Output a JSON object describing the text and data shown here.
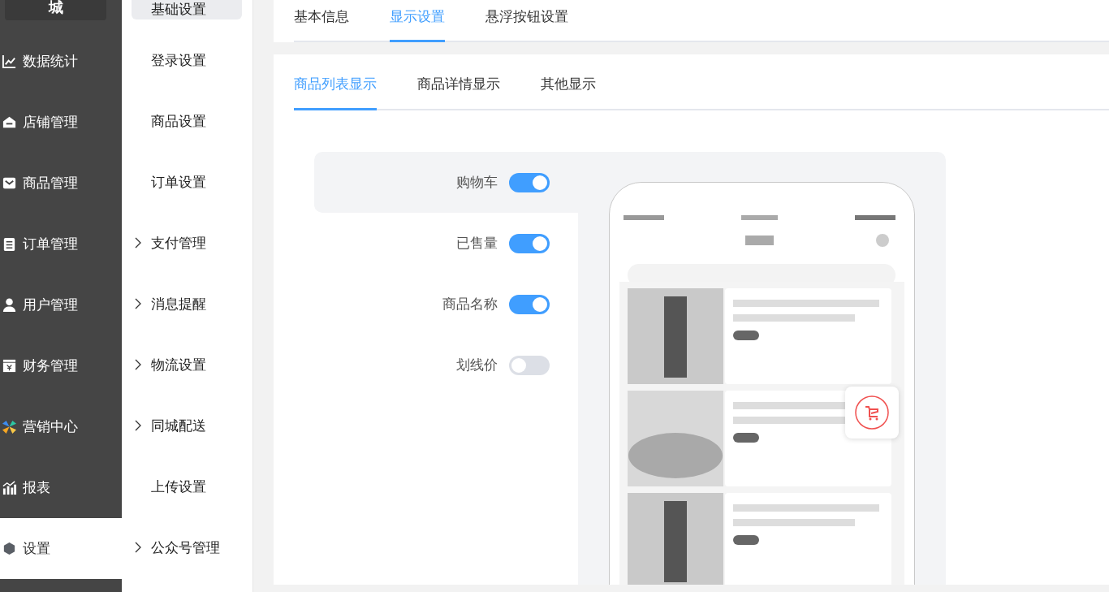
{
  "sidebar": {
    "logo": "城",
    "items": [
      {
        "label": "数据统计",
        "selected": false
      },
      {
        "label": "店铺管理",
        "selected": false
      },
      {
        "label": "商品管理",
        "selected": false
      },
      {
        "label": "订单管理",
        "selected": false
      },
      {
        "label": "用户管理",
        "selected": false
      },
      {
        "label": "财务管理",
        "selected": false
      },
      {
        "label": "营销中心",
        "selected": false
      },
      {
        "label": "报表",
        "selected": false
      },
      {
        "label": "设置",
        "selected": true
      }
    ]
  },
  "submenu": {
    "items": [
      {
        "label": "基础设置",
        "selected": true,
        "expandable": false
      },
      {
        "label": "登录设置",
        "selected": false,
        "expandable": false
      },
      {
        "label": "商品设置",
        "selected": false,
        "expandable": false
      },
      {
        "label": "订单设置",
        "selected": false,
        "expandable": false
      },
      {
        "label": "支付管理",
        "selected": false,
        "expandable": true
      },
      {
        "label": "消息提醒",
        "selected": false,
        "expandable": true
      },
      {
        "label": "物流设置",
        "selected": false,
        "expandable": true
      },
      {
        "label": "同城配送",
        "selected": false,
        "expandable": true
      },
      {
        "label": "上传设置",
        "selected": false,
        "expandable": false
      },
      {
        "label": "公众号管理",
        "selected": false,
        "expandable": true
      }
    ]
  },
  "tabs": [
    {
      "label": "基本信息",
      "selected": false
    },
    {
      "label": "显示设置",
      "selected": true
    },
    {
      "label": "悬浮按钮设置",
      "selected": false
    }
  ],
  "subtabs": [
    {
      "label": "商品列表显示",
      "selected": true
    },
    {
      "label": "商品详情显示",
      "selected": false
    },
    {
      "label": "其他显示",
      "selected": false
    }
  ],
  "display_options": [
    {
      "label": "购物车",
      "on": true,
      "selected": true
    },
    {
      "label": "已售量",
      "on": true,
      "selected": false
    },
    {
      "label": "商品名称",
      "on": true,
      "selected": false
    },
    {
      "label": "划线价",
      "on": false,
      "selected": false
    }
  ]
}
